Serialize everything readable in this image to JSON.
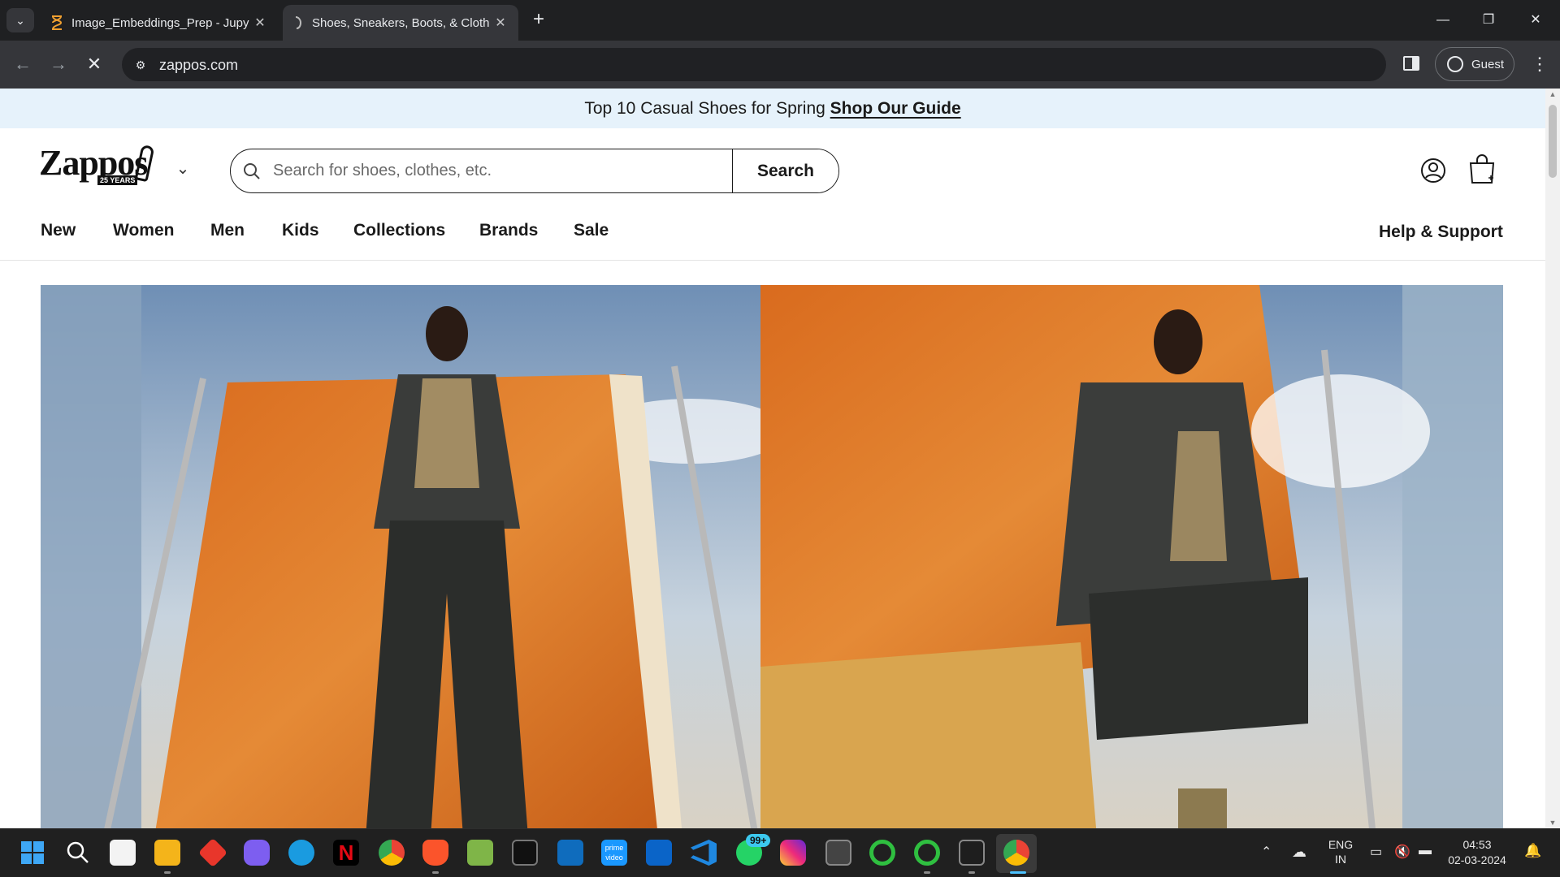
{
  "browser": {
    "tabs": [
      {
        "title": "Image_Embeddings_Prep - Jupy",
        "icon": "hourglass-icon",
        "active": false
      },
      {
        "title": "Shoes, Sneakers, Boots, & Cloth",
        "icon": "zappos-favicon",
        "active": true
      }
    ],
    "new_tab": "+",
    "window_controls": {
      "minimize": "—",
      "restore": "❐",
      "close": "✕"
    },
    "url": "zappos.com",
    "profile_label": "Guest"
  },
  "site": {
    "promo": {
      "text": "Top 10 Casual Shoes for Spring",
      "link": "Shop Our Guide"
    },
    "logo": {
      "brand": "Zappos",
      "badge": "25 YEARS"
    },
    "search": {
      "placeholder": "Search for shoes, clothes, etc.",
      "button": "Search"
    },
    "nav": [
      "New",
      "Women",
      "Men",
      "Kids",
      "Collections",
      "Brands",
      "Sale"
    ],
    "help": "Help & Support"
  },
  "taskbar": {
    "apps": [
      "start",
      "search",
      "store",
      "file-explorer",
      "app-red",
      "copilot",
      "edge",
      "netflix",
      "chrome",
      "brave",
      "photos",
      "terminal-dark",
      "app-blue",
      "prime-video",
      "outlook",
      "vscode",
      "whatsapp",
      "instagram",
      "app-window",
      "app-ring-1",
      "app-ring-2",
      "terminal",
      "chrome-active"
    ],
    "whatsapp_badge": "99+",
    "language": {
      "line1": "ENG",
      "line2": "IN"
    },
    "time": "04:53",
    "date": "02-03-2024"
  },
  "colors": {
    "promo_bg": "#e6f2fb",
    "chrome_dark": "#202124",
    "accent": "#1a1a1a"
  }
}
